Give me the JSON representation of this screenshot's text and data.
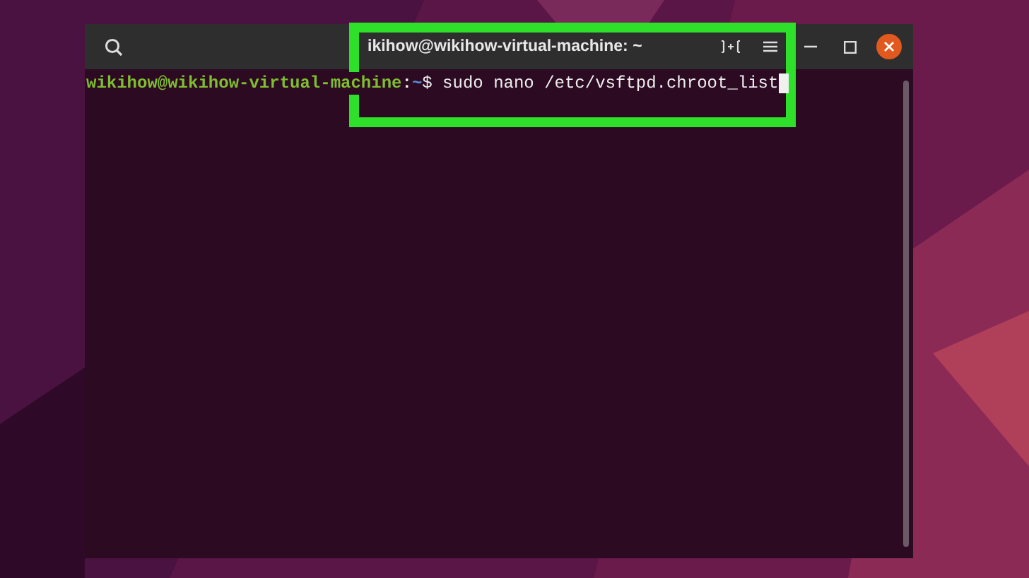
{
  "window": {
    "title": "ikihow@wikihow-virtual-machine: ~"
  },
  "terminal": {
    "lines": [
      {
        "user_host": "wikihow@wikihow-virtual-machine",
        "separator": ":",
        "path": "~",
        "prompt": "$",
        "command": "sudo nano /etc/vsftpd.chroot_list"
      }
    ]
  }
}
